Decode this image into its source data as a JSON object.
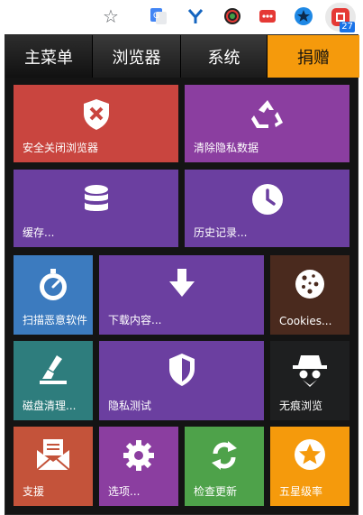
{
  "colors": {
    "red": "#c9453f",
    "purple": "#8b3ea0",
    "violet": "#6b3fa0",
    "blue": "#3c7bbf",
    "brown": "#4a2a1e",
    "teal": "#2e7d7d",
    "dark": "#1e1f20",
    "orange": "#c4533a",
    "green": "#4ea24a",
    "amber": "#f59a0c"
  },
  "badge": "27",
  "nav": {
    "tabs": [
      "主菜单",
      "浏览器",
      "系统",
      "捐赠"
    ]
  },
  "tiles": [
    {
      "label": "安全关闭浏览器",
      "icon": "shield-x-icon"
    },
    {
      "label": "清除隐私数据",
      "icon": "recycle-icon"
    },
    {
      "label": "缓存...",
      "icon": "database-icon"
    },
    {
      "label": "历史记录...",
      "icon": "clock-icon"
    },
    {
      "label": "扫描恶意软件",
      "icon": "stopwatch-icon"
    },
    {
      "label": "下载内容...",
      "icon": "download-arrow-icon"
    },
    {
      "label": "Cookies...",
      "icon": "cookie-icon"
    },
    {
      "label": "磁盘清理...",
      "icon": "broom-icon"
    },
    {
      "label": "隐私测试",
      "icon": "shield-half-icon"
    },
    {
      "label": "无痕浏览",
      "icon": "incognito-spy-icon"
    },
    {
      "label": "支援",
      "icon": "envelope-letter-icon"
    },
    {
      "label": "选项...",
      "icon": "gear-icon"
    },
    {
      "label": "检查更新",
      "icon": "refresh-arrows-icon"
    },
    {
      "label": "五星级率",
      "icon": "star-circle-icon"
    }
  ]
}
